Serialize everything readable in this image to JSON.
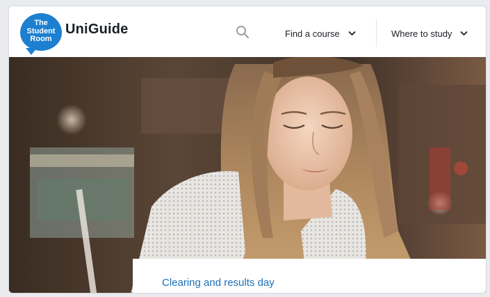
{
  "header": {
    "logo": {
      "badge_line1": "The",
      "badge_line2": "Student",
      "badge_line3": "Room",
      "wordmark": "UniGuide"
    },
    "search_icon": "search-icon",
    "nav": [
      {
        "label": "Find a course",
        "icon": "chevron-down-icon"
      },
      {
        "label": "Where to study",
        "icon": "chevron-down-icon"
      }
    ]
  },
  "hero": {
    "image": "student-reading-photo",
    "card_link": "Clearing and results day"
  },
  "colors": {
    "brand_blue": "#1d7fd0",
    "link_blue": "#1a6fb8",
    "text_dark": "#1b1e26"
  }
}
